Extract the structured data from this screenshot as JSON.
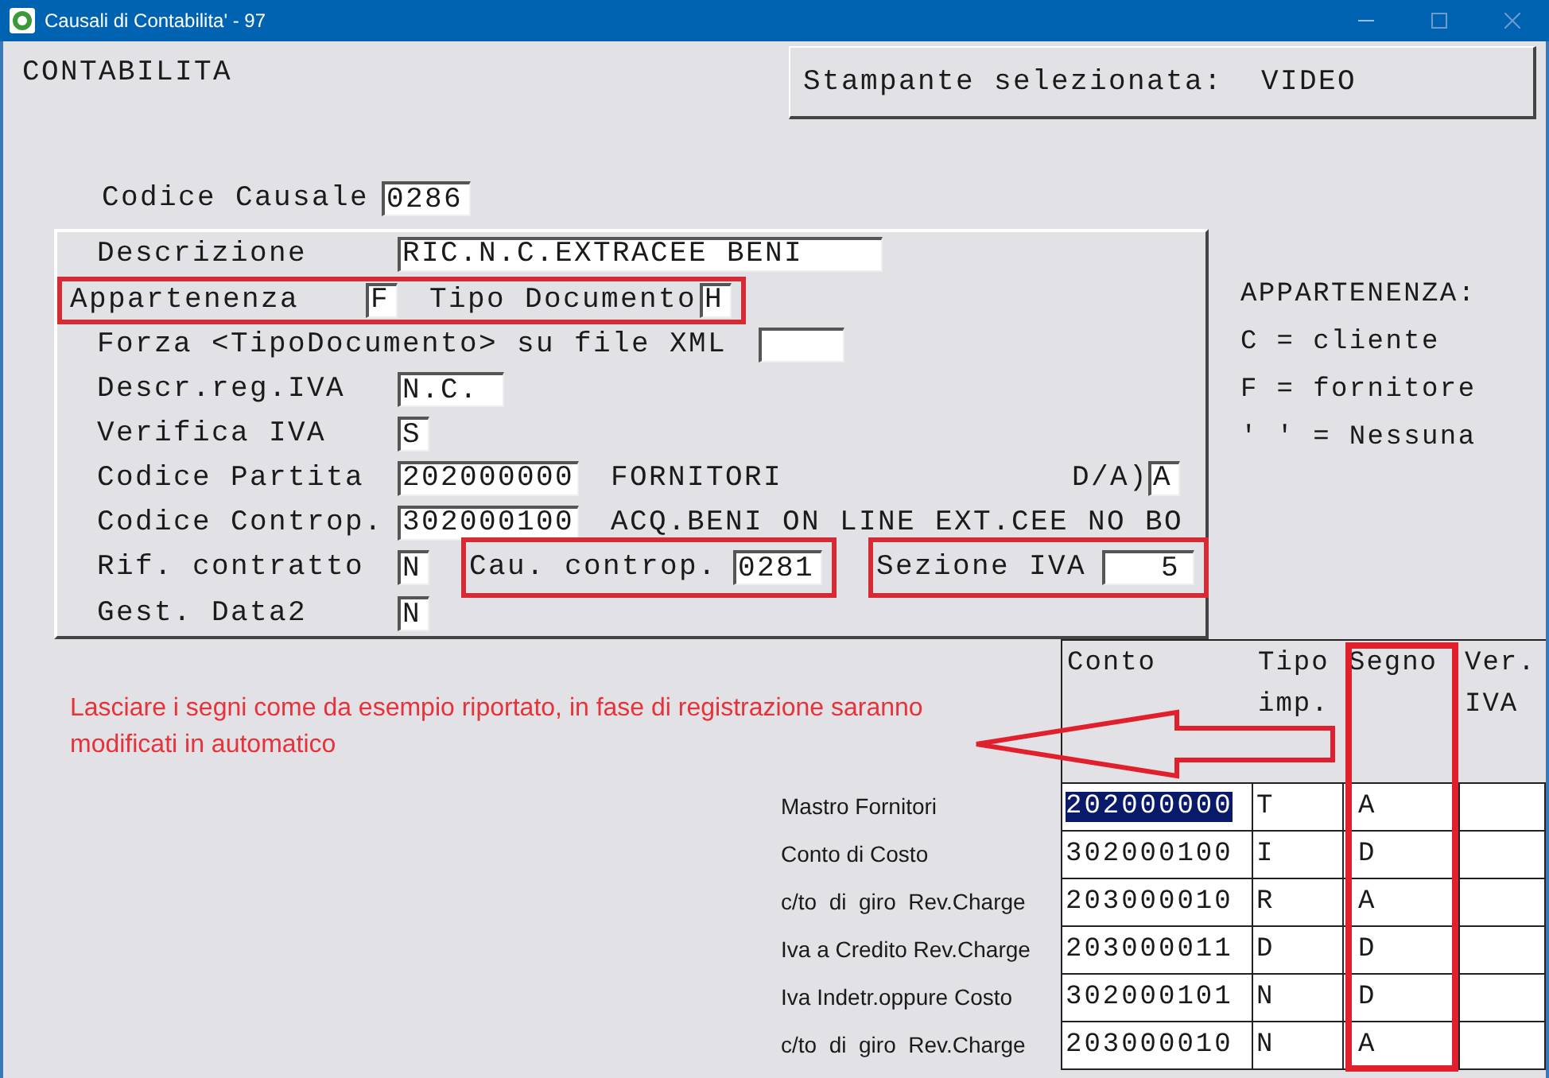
{
  "window": {
    "title": "Causali di Contabilita' - 97"
  },
  "heading": "CONTABILITA",
  "printer": "Stampante selezionata:  VIDEO",
  "causale": {
    "label": "Codice Causale",
    "value": "0286",
    "kind": "code"
  },
  "form_rows": [
    {
      "items": [
        {
          "kind": "label",
          "text": "Descrizione"
        },
        {
          "kind": "description",
          "value": "RIC.N.C.EXTRACEE BENI"
        }
      ]
    },
    {
      "items": [
        {
          "kind": "frame",
          "items": [
            {
              "kind": "label",
              "text": "Appartenenza"
            },
            {
              "kind": "flag",
              "value": "F"
            },
            {
              "kind": "text",
              "text": "Tipo Documento"
            },
            {
              "kind": "flag",
              "value": "H"
            }
          ]
        }
      ]
    },
    {
      "items": [
        {
          "kind": "text",
          "text": "Forza <TipoDocumento> su file XML"
        },
        {
          "kind": "blank"
        }
      ]
    },
    {
      "items": [
        {
          "kind": "label",
          "text": "Descr.reg.IVA"
        },
        {
          "kind": "short",
          "value": "N.C."
        }
      ]
    },
    {
      "items": [
        {
          "kind": "label",
          "text": "Verifica IVA"
        },
        {
          "kind": "flag",
          "value": "S"
        }
      ]
    },
    {
      "items": [
        {
          "kind": "label",
          "text": "Codice Partita"
        },
        {
          "kind": "account",
          "value": "202000000"
        },
        {
          "kind": "text",
          "text": "FORNITORI"
        }
      ],
      "trailing": [
        {
          "kind": "text",
          "text": "D/A)"
        },
        {
          "kind": "flag",
          "value": "A"
        }
      ]
    },
    {
      "items": [
        {
          "kind": "label",
          "text": "Codice Controp."
        },
        {
          "kind": "account",
          "value": "302000100"
        },
        {
          "kind": "text",
          "text": "ACQ.BENI ON LINE EXT.CEE NO BO"
        }
      ]
    },
    {
      "items": [
        {
          "kind": "label",
          "text": "Rif. contratto"
        },
        {
          "kind": "flag",
          "value": "N"
        },
        {
          "kind": "frame",
          "items": [
            {
              "kind": "text",
              "text": "Cau. controp."
            },
            {
              "kind": "code",
              "value": "0281"
            }
          ]
        },
        {
          "kind": "frame",
          "items": [
            {
              "kind": "text",
              "text": "Sezione IVA"
            },
            {
              "kind": "number",
              "value": "5"
            }
          ]
        }
      ]
    },
    {
      "items": [
        {
          "kind": "label",
          "text": "Gest. Data2"
        },
        {
          "kind": "flag",
          "value": "N"
        }
      ]
    }
  ],
  "legend": [
    "APPARTENENZA:",
    "C = cliente",
    "F = fornitore",
    "' ' = Nessuna"
  ],
  "note": "Lasciare i segni come da esempio riportato, in fase di registrazione saranno modificati in automatico",
  "table": {
    "columns": [
      {
        "label": "Conto",
        "highlighted": false
      },
      {
        "label": "Tipo imp.",
        "highlighted": false
      },
      {
        "label": "Segno",
        "highlighted": true
      },
      {
        "label": "Ver. IVA",
        "highlighted": false
      }
    ],
    "rows": [
      {
        "label": "Mastro Fornitori",
        "conto": "202000000",
        "tipo": "T",
        "segno": "A",
        "selected": true
      },
      {
        "label": "Conto di Costo",
        "conto": "302000100",
        "tipo": "I",
        "segno": "D",
        "selected": false
      },
      {
        "label": "c/to  di  giro  Rev.Charge",
        "conto": "203000010",
        "tipo": "R",
        "segno": "A",
        "selected": false
      },
      {
        "label": "Iva a Credito Rev.Charge",
        "conto": "203000011",
        "tipo": "D",
        "segno": "D",
        "selected": false
      },
      {
        "label": "Iva Indetr.oppure Costo",
        "conto": "302000101",
        "tipo": "N",
        "segno": "D",
        "selected": false
      },
      {
        "label": "c/to  di  giro  Rev.Charge",
        "conto": "203000010",
        "tipo": "N",
        "segno": "A",
        "selected": false
      }
    ]
  }
}
